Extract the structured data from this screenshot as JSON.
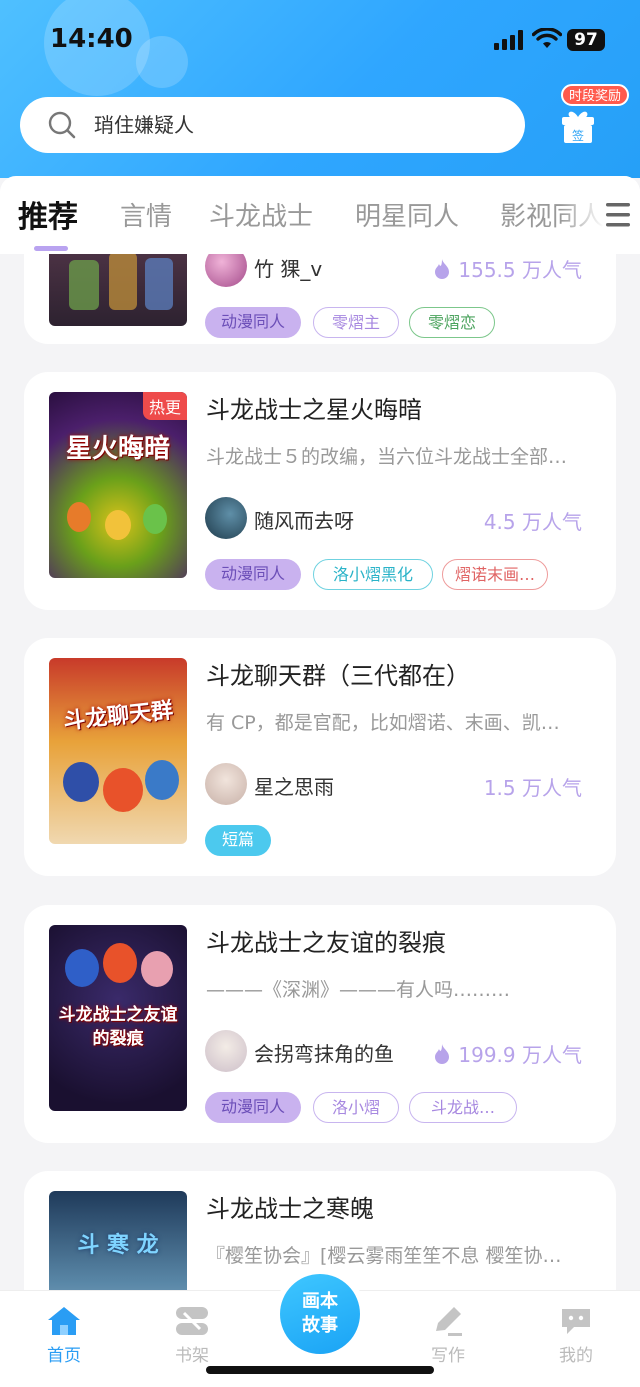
{
  "status": {
    "time": "14:40",
    "battery": "97"
  },
  "search": {
    "placeholder": "琑住嫌疑人"
  },
  "reward": {
    "badge": "时段奖励",
    "sign": "签"
  },
  "tabs": [
    {
      "label": "推荐",
      "active": true
    },
    {
      "label": "言情"
    },
    {
      "label": "斗龙战士"
    },
    {
      "label": "明星同人"
    },
    {
      "label": "影视同人"
    }
  ],
  "cards": [
    {
      "author": "竹 猓_v",
      "popularity": "155.5 万人气",
      "tags": [
        "动漫同人",
        "零熠主",
        "零熠恋"
      ]
    },
    {
      "title": "斗龙战士之星火晦暗",
      "desc": "斗龙战士５的改编，当六位斗龙战士全部…",
      "author": "随风而去呀",
      "popularity": "4.5 万人气",
      "hot": "热更",
      "cover_text": "星火晦暗",
      "tags": [
        "动漫同人",
        "洛小熠黑化",
        "熠诺末画…"
      ]
    },
    {
      "title": "斗龙聊天群（三代都在）",
      "desc": "有 CP，都是官配，比如熠诺、末画、凯…",
      "author": "星之思雨",
      "popularity": "1.5 万人气",
      "cover_text": "斗龙聊天群",
      "tags": [
        "短篇"
      ]
    },
    {
      "title": "斗龙战士之友谊的裂痕",
      "desc": "———《深渊》———有人吗………",
      "author": "会拐弯抹角的鱼",
      "popularity": "199.9 万人气",
      "cover_text": "斗龙战士之友谊的裂痕",
      "tags": [
        "动漫同人",
        "洛小熠",
        "斗龙战…"
      ]
    },
    {
      "title": "斗龙战士之寒魄",
      "desc": "『樱笙协会』[樱云雾雨笙笙不息 樱笙协…",
      "cover_text": "斗 寒 龙"
    }
  ],
  "nav": {
    "home": "首页",
    "shelf": "书架",
    "center_line1": "画本",
    "center_line2": "故事",
    "write": "写作",
    "me": "我的"
  },
  "colors": {
    "accent": "#2a9df4",
    "popularity": "#b7a3ea"
  }
}
